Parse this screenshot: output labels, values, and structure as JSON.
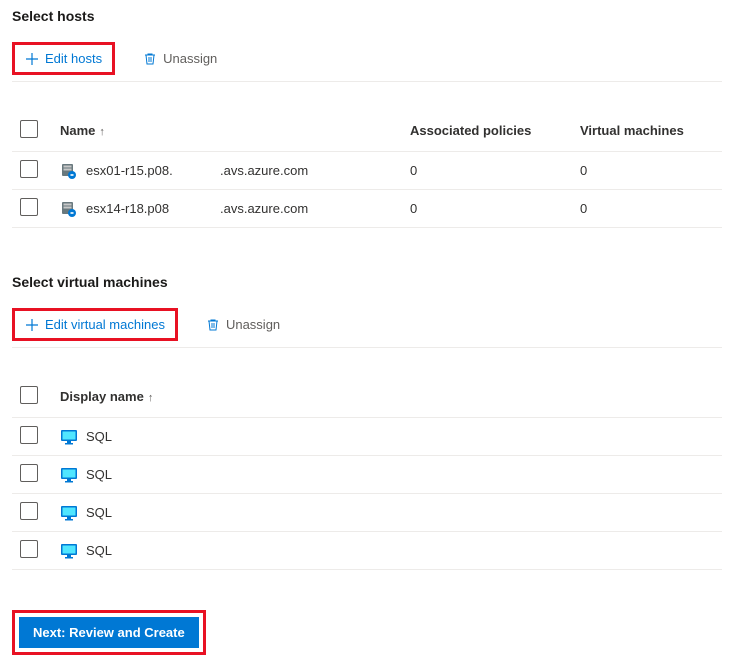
{
  "sections": {
    "hosts": {
      "title": "Select hosts",
      "edit_label": "Edit hosts",
      "unassign_label": "Unassign",
      "columns": {
        "name": "Name",
        "policies": "Associated policies",
        "vms": "Virtual machines"
      },
      "rows": [
        {
          "name": "esx01-r15.p08.",
          "domain": ".avs.azure.com",
          "policies": "0",
          "vms": "0"
        },
        {
          "name": "esx14-r18.p08",
          "domain": ".avs.azure.com",
          "policies": "0",
          "vms": "0"
        }
      ]
    },
    "vms": {
      "title": "Select virtual machines",
      "edit_label": "Edit virtual machines",
      "unassign_label": "Unassign",
      "columns": {
        "name": "Display name"
      },
      "rows": [
        {
          "name": "SQL"
        },
        {
          "name": "SQL"
        },
        {
          "name": "SQL"
        },
        {
          "name": "SQL"
        }
      ]
    }
  },
  "footer": {
    "next_label": "Next: Review and Create"
  }
}
